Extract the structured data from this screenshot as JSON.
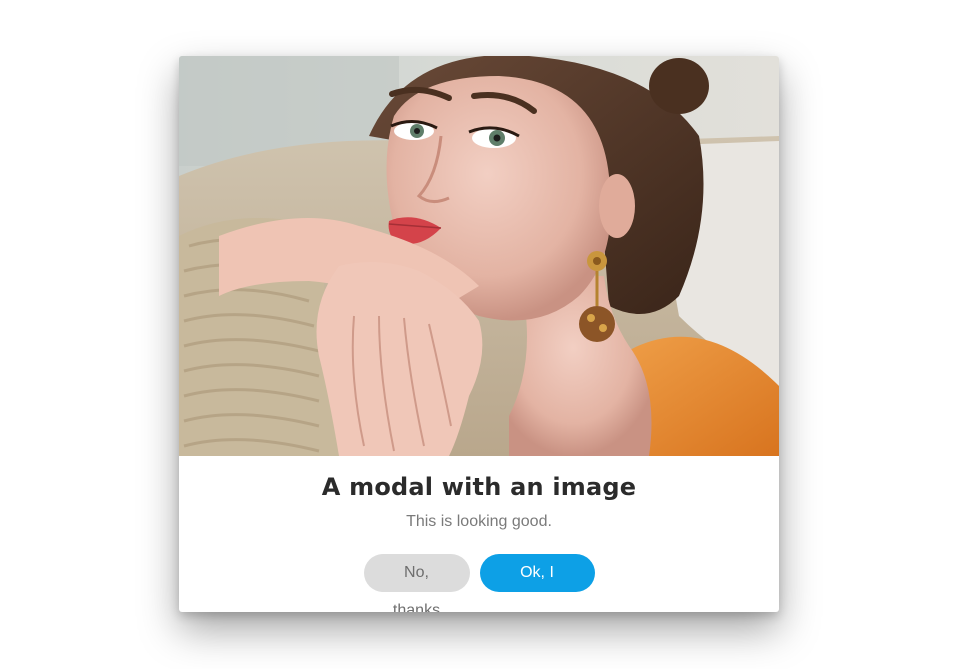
{
  "modal": {
    "image": {
      "subject": "portrait-photo"
    },
    "title": "A modal with an image",
    "text": "This is looking good.",
    "cancel_label": "No, thanks",
    "confirm_label": "Ok, I accept"
  },
  "colors": {
    "confirm_button": "#0da0e6",
    "cancel_button": "#dcdcdc",
    "title": "#2b2b2b",
    "text": "#7a7a7a"
  }
}
